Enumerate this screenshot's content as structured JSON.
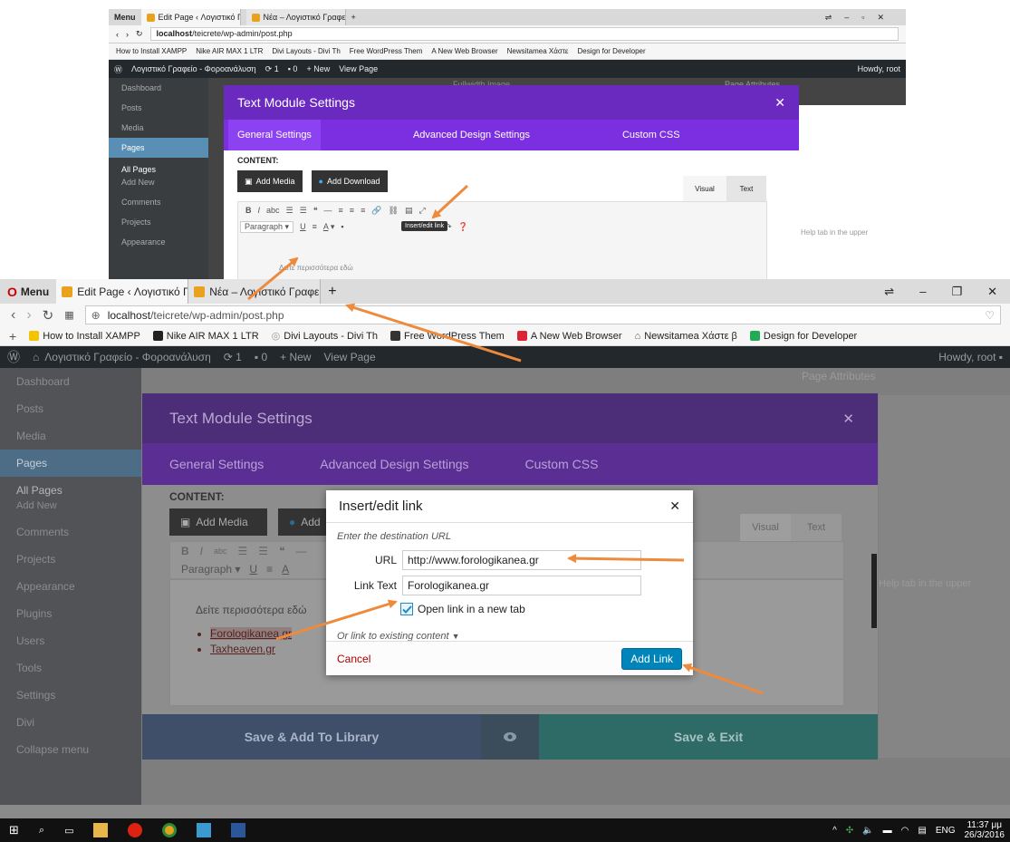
{
  "mini": {
    "menu": "Menu",
    "tabs": [
      "Edit Page ‹ Λογιστικό Γραφ",
      "Νέα – Λογιστικό Γραφείο"
    ],
    "url_host": "localhost",
    "url_path": "/teicrete/wp-admin/post.php",
    "bookmarks": [
      "How to Install XAMPP",
      "Nike AIR MAX 1 LTR",
      "Divi Layouts - Divi Th",
      "Free WordPress Them",
      "A New Web Browser",
      "Newsitamea Χάστε",
      "Design for Developer"
    ],
    "wp_bar": {
      "site": "Λογιστικό Γραφείο - Φοροανάλυση",
      "updates": "1",
      "comments": "0",
      "new": "New",
      "view": "View Page",
      "howdy": "Howdy, root"
    },
    "sidebar": [
      "Dashboard",
      "Posts",
      "Media",
      "Pages",
      "All Pages",
      "Add New",
      "Comments",
      "Projects",
      "Appearance"
    ],
    "modal_title": "Text Module Settings",
    "modal_tabs": [
      "General Settings",
      "Advanced Design Settings",
      "Custom CSS"
    ],
    "content_label": "CONTENT:",
    "add_media": "Add Media",
    "add_download": "Add Download",
    "visual": "Visual",
    "text": "Text",
    "paragraph": "Paragraph",
    "tooltip": "Insert/edit link",
    "editor_text": "Δείτε περισσότερα εδώ",
    "help_text": "Help tab in the upper",
    "ghost_fullwidth": "Fullwidth Image",
    "ghost_attr": "Page Attributes"
  },
  "browser": {
    "menu": "Menu",
    "tabs": [
      {
        "label": "Edit Page ‹ Λογιστικό Γραφ"
      },
      {
        "label": "Νέα – Λογιστικό Γραφείο"
      }
    ],
    "url_host": "localhost",
    "url_path": "/teicrete/wp-admin/post.php",
    "bookmarks": [
      "How to Install XAMPP",
      "Nike AIR MAX 1 LTR",
      "Divi Layouts - Divi Th",
      "Free WordPress Them",
      "A New Web Browser",
      "Newsitamea Χάστε β",
      "Design for Developer"
    ]
  },
  "wp_bar": {
    "site": "Λογιστικό Γραφείο - Φοροανάλυση",
    "updates": "1",
    "comments": "0",
    "new": "New",
    "view": "View Page",
    "howdy": "Howdy, root"
  },
  "sidebar": {
    "items": [
      "Dashboard",
      "Posts",
      "Media",
      "Pages",
      "All Pages",
      "Add New",
      "Comments",
      "Projects",
      "Appearance",
      "Plugins",
      "Users",
      "Tools",
      "Settings",
      "Divi",
      "Collapse menu"
    ]
  },
  "page_attributes": "Page Attributes",
  "modal": {
    "title": "Text Module Settings",
    "tabs": [
      "General Settings",
      "Advanced Design Settings",
      "Custom CSS"
    ],
    "content_label": "CONTENT:",
    "add_media": "Add Media",
    "add_download": "Add",
    "visual": "Visual",
    "text": "Text",
    "paragraph": "Paragraph",
    "editor_text": "Δείτε περισσότερα εδώ",
    "list": [
      "Forologikanea.gr",
      "Taxheaven.gr"
    ],
    "help_text": "Help tab in the upper",
    "save_library": "Save & Add To Library",
    "save_exit": "Save & Exit"
  },
  "dialog": {
    "title": "Insert/edit link",
    "desc": "Enter the destination URL",
    "url_label": "URL",
    "url_value": "http://www.forologikanea.gr",
    "link_label": "Link Text",
    "link_value": "Forologikanea.gr",
    "new_tab": "Open link in a new tab",
    "new_tab_checked": true,
    "existing": "Or link to existing content",
    "cancel": "Cancel",
    "add": "Add Link"
  },
  "taskbar": {
    "lang": "ENG",
    "time": "11:37 μμ",
    "date": "26/3/2016"
  },
  "colors": {
    "arrow": "#ee8a3c",
    "wp_blue": "#0085ba",
    "purple": "#7b2fe0"
  }
}
